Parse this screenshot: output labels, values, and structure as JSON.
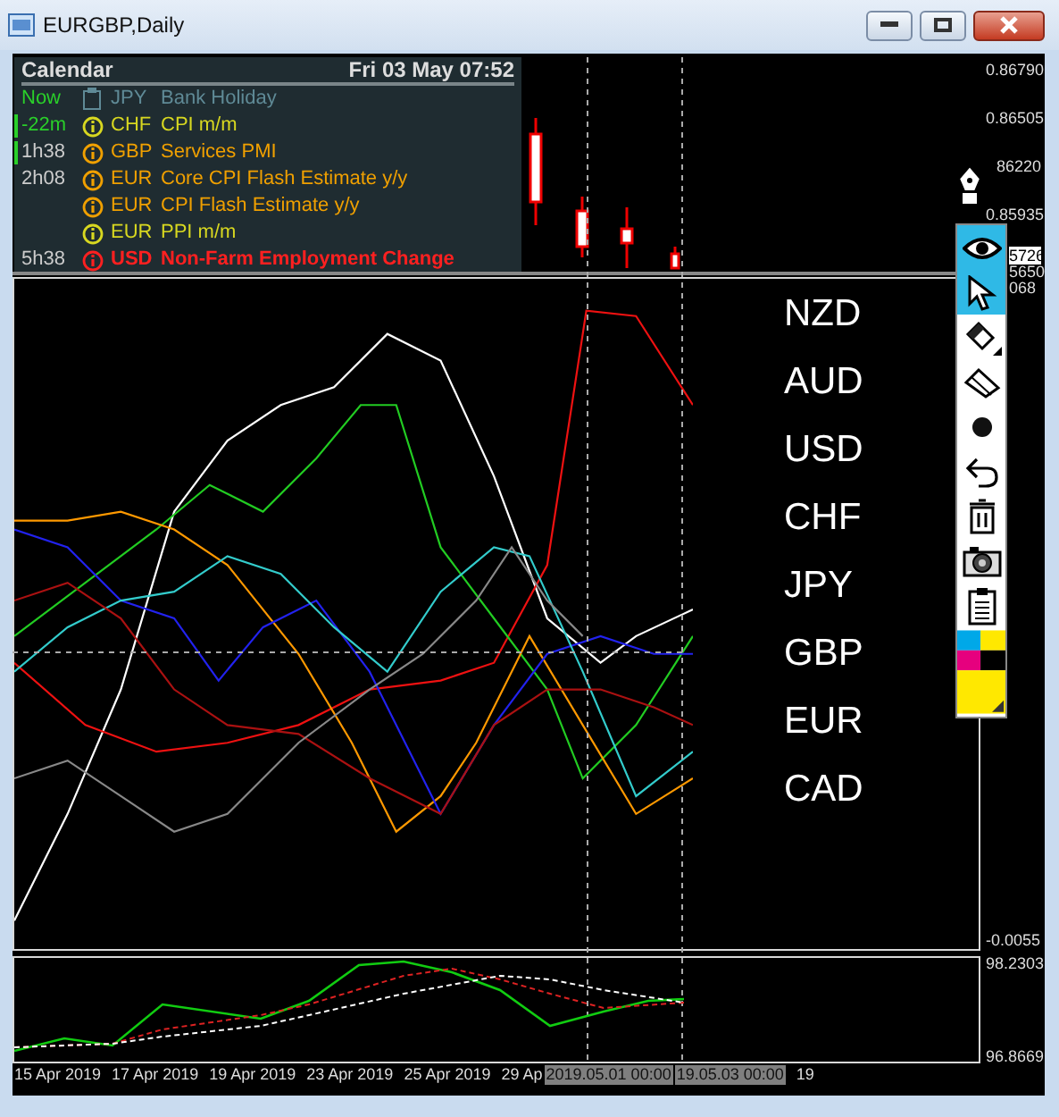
{
  "window": {
    "title": "EURGBP,Daily"
  },
  "calendar": {
    "title": "Calendar",
    "datetime": "Fri 03 May 07:52",
    "events": [
      {
        "time": "Now",
        "currency": "JPY",
        "event": "Bank Holiday",
        "kind": "holiday",
        "color": "#5f8a96",
        "flagged": false
      },
      {
        "time": "-22m",
        "currency": "CHF",
        "event": "CPI m/m",
        "kind": "info",
        "color": "#d8d820",
        "flagged": true
      },
      {
        "time": "1h38",
        "currency": "GBP",
        "event": "Services PMI",
        "kind": "info",
        "color": "#f0a000",
        "flagged": true
      },
      {
        "time": "2h08",
        "currency": "EUR",
        "event": "Core CPI Flash Estimate y/y",
        "kind": "info",
        "color": "#f0a000",
        "flagged": false
      },
      {
        "currency": "EUR",
        "event": "CPI Flash Estimate y/y",
        "kind": "info",
        "color": "#f0a000",
        "flagged": false
      },
      {
        "currency": "EUR",
        "event": "PPI m/m",
        "kind": "info",
        "color": "#d8d820",
        "flagged": false
      },
      {
        "time": "5h38",
        "currency": "USD",
        "event": "Non-Farm Employment Change",
        "kind": "alert",
        "color": "#ff2020",
        "flagged": false
      }
    ]
  },
  "price_axis": [
    {
      "text": "0.86790"
    },
    {
      "text": "0.86505"
    },
    {
      "text": "86220",
      "kind": "partial"
    },
    {
      "text": "0.85935"
    },
    {
      "text": "5726",
      "kind": "current"
    },
    {
      "text": "5650",
      "kind": "partial"
    },
    {
      "text": "068",
      "kind": "partial"
    }
  ],
  "currencies": [
    "NZD",
    "AUD",
    "USD",
    "CHF",
    "JPY",
    "GBP",
    "EUR",
    "CAD"
  ],
  "strength_axis": [
    "-0.0055"
  ],
  "indicator_axis": [
    "98.2303",
    "96.8669"
  ],
  "time_axis": [
    {
      "text": "15 Apr 2019"
    },
    {
      "text": "17 Apr 2019"
    },
    {
      "text": "19 Apr 2019"
    },
    {
      "text": "23 Apr 2019"
    },
    {
      "text": "25 Apr 2019"
    },
    {
      "text": "29 Ap"
    },
    {
      "text": "2019.05.01 00:00",
      "kind": "crosshair"
    },
    {
      "text": "19.05.03 00:00",
      "kind": "crosshair"
    },
    {
      "text": "19"
    }
  ],
  "toolbar": [
    {
      "kind": "eye",
      "selected": true
    },
    {
      "kind": "cursor",
      "selected": true
    },
    {
      "kind": "pencil",
      "selected": false
    },
    {
      "kind": "eraser",
      "selected": false
    },
    {
      "kind": "dot",
      "selected": false
    },
    {
      "kind": "undo",
      "selected": false
    },
    {
      "kind": "trash",
      "selected": false
    },
    {
      "kind": "camera",
      "selected": false
    },
    {
      "kind": "clipboard",
      "selected": false
    },
    {
      "kind": "palette",
      "selected": false
    }
  ]
}
